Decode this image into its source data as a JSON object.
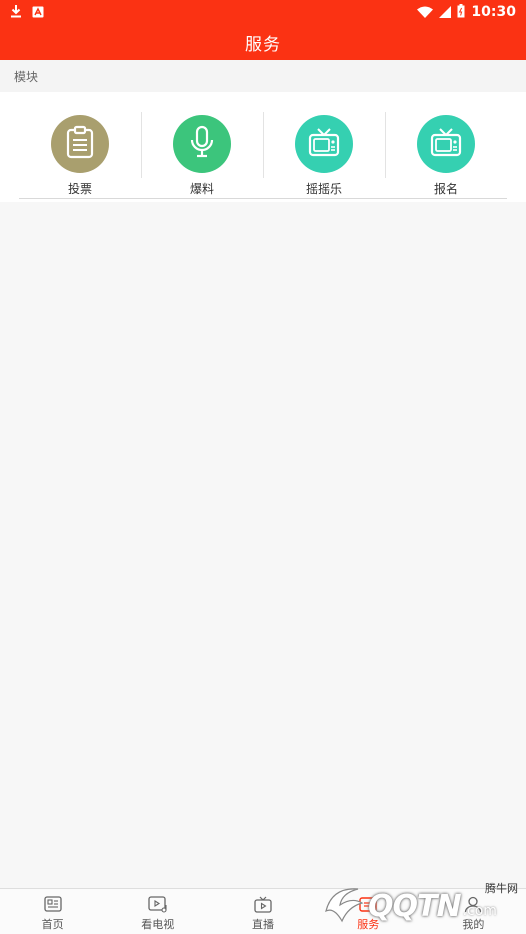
{
  "status_bar": {
    "time": "10:30",
    "icons": [
      "download-icon",
      "app-badge-icon",
      "wifi-icon",
      "signal-icon",
      "battery-icon"
    ]
  },
  "header": {
    "title": "服务"
  },
  "section": {
    "label": "模块"
  },
  "modules": [
    {
      "label": "投票",
      "icon": "clipboard-icon",
      "color": "#a99f6e"
    },
    {
      "label": "爆料",
      "icon": "microphone-icon",
      "color": "#3cc57c"
    },
    {
      "label": "摇摇乐",
      "icon": "tv-icon",
      "color": "#35d0b1"
    },
    {
      "label": "报名",
      "icon": "tv-icon",
      "color": "#35d0b1"
    }
  ],
  "tabs": [
    {
      "label": "首页",
      "icon": "news-icon",
      "active": false
    },
    {
      "label": "看电视",
      "icon": "tv-music-icon",
      "active": false
    },
    {
      "label": "直播",
      "icon": "live-icon",
      "active": false
    },
    {
      "label": "服务",
      "icon": "service-icon",
      "active": true
    },
    {
      "label": "我的",
      "icon": "user-icon",
      "active": false
    }
  ],
  "watermark": {
    "main": "QQTN",
    "com": ".com",
    "sub": "腾牛网"
  },
  "colors": {
    "brand": "#fb3213",
    "background": "#f7f7f7"
  }
}
